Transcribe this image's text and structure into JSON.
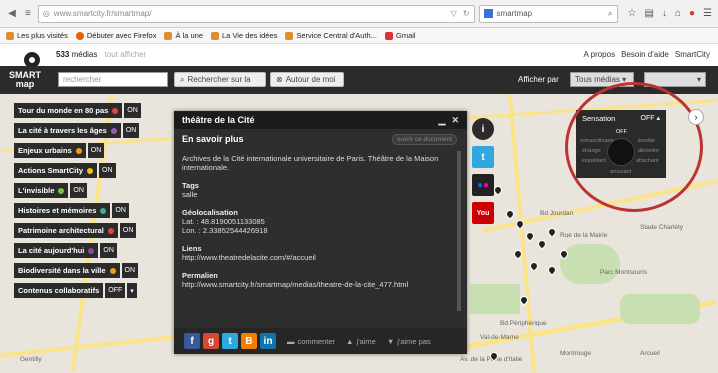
{
  "browser": {
    "url": "www.smartcity.fr/smartmap/",
    "search_value": "smartmap",
    "bookmarks": [
      "Les plus visités",
      "Débuter avec Firefox",
      "À la une",
      "La Vie des idées",
      "Service Central d'Auth...",
      "Gmail"
    ]
  },
  "site": {
    "media_count": "533",
    "media_label": "médias",
    "show_all": "tout afficher",
    "links": [
      "A propos",
      "Besoin d'aide",
      "SmartCity"
    ],
    "logo_line1": "SMART",
    "logo_line2": "map",
    "search_placeholder": "rechercher",
    "search_button": "Rechercher sur la",
    "around_button": "Autour de moi",
    "display_by": "Afficher par",
    "display_select": "Tous médias"
  },
  "layers": [
    {
      "label": "Tour du monde en 80 pas",
      "color": "#e2453b",
      "state": "ON"
    },
    {
      "label": "La cité à travers les âges",
      "color": "#9b59b6",
      "state": "ON"
    },
    {
      "label": "Enjeux urbains",
      "color": "#f39c12",
      "state": "ON"
    },
    {
      "label": "Actions SmartCity",
      "color": "#f1c40f",
      "state": "ON"
    },
    {
      "label": "L'invisible",
      "color": "#7ac143",
      "state": "ON"
    },
    {
      "label": "Histoires et mémoires",
      "color": "#3fae9a",
      "state": "ON"
    },
    {
      "label": "Patrimoine architectural",
      "color": "#e2453b",
      "state": "ON"
    },
    {
      "label": "La cité aujourd'hui",
      "color": "#8e44ad",
      "state": "ON"
    },
    {
      "label": "Biodiversité dans la ville",
      "color": "#f39c12",
      "state": "ON"
    },
    {
      "label": "Contenus collaboratifs",
      "color": "",
      "state": "OFF"
    }
  ],
  "popup": {
    "title": "théâtre de la Cité",
    "subtitle": "En savoir plus",
    "doc_button": "ouvrir ce document",
    "description": "Archives de la Cité internationale universitaire de Paris. Théâtre de la Maison internationale.",
    "tags_label": "Tags",
    "tags_value": "salle",
    "geo_label": "Géolocalisation",
    "lat": "Lat. : 48.8190051133085",
    "lon": "Lon. : 2.33852544426918",
    "links_label": "Liens",
    "links_value": "http://www.theatredelacite.com/#/accueil",
    "permalink_label": "Permalien",
    "permalink_value": "http://www.smartcity.fr/smartmap/medias/theatre-de-la-cite_477.html",
    "comment": "commenter",
    "like": "j'aime",
    "dislike": "j'aime pas"
  },
  "sensation": {
    "label": "Sensation",
    "state": "OFF",
    "center": "OFF",
    "words": [
      "extraordinaire",
      "insolite",
      "étrange",
      "dérisoire",
      "inquiétant",
      "attachant",
      "amusant"
    ]
  },
  "map_labels": [
    "Bd Jourdan",
    "Bd Périphérique",
    "Rue de la Mairie",
    "Parc Montsouris",
    "Stade Charléty",
    "Gentilly",
    "Montrouge",
    "Arcueil",
    "Av. de la Porte d'Italie",
    "Val-de-Marne"
  ]
}
